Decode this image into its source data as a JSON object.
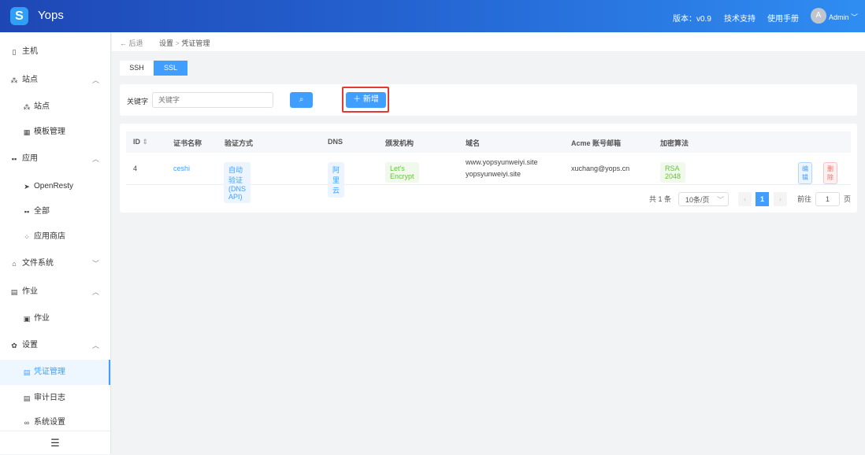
{
  "header": {
    "logo": "S",
    "brand": "Yops",
    "version": "版本：v0.9",
    "support": "技术支持",
    "manual": "使用手册",
    "avatar": "A",
    "user": "Admin"
  },
  "sidebar": {
    "items": [
      {
        "label": "主机",
        "icon": "host-icon"
      },
      {
        "label": "站点",
        "icon": "site-icon"
      },
      {
        "label": "站点",
        "icon": "site-icon"
      },
      {
        "label": "模板管理",
        "icon": "template-icon"
      },
      {
        "label": "应用",
        "icon": "apps-icon"
      },
      {
        "label": "OpenResty",
        "icon": "openresty-icon"
      },
      {
        "label": "全部",
        "icon": "grid-icon"
      },
      {
        "label": "应用商店",
        "icon": "store-icon"
      },
      {
        "label": "文件系统",
        "icon": "filesystem-icon"
      },
      {
        "label": "作业",
        "icon": "job-icon"
      },
      {
        "label": "作业",
        "icon": "clipboard-icon"
      },
      {
        "label": "设置",
        "icon": "gear-icon"
      },
      {
        "label": "凭证管理",
        "icon": "credential-icon"
      },
      {
        "label": "审计日志",
        "icon": "log-icon"
      },
      {
        "label": "系统设置",
        "icon": "link-icon"
      }
    ]
  },
  "breadcrumb": {
    "back": "后退",
    "parent": "设置",
    "current": "凭证管理"
  },
  "tabs": [
    "SSH",
    "SSL"
  ],
  "search": {
    "label": "关键字",
    "placeholder": "关键字",
    "add": "新增"
  },
  "table": {
    "headers": [
      "ID",
      "证书名称",
      "验证方式",
      "DNS",
      "颁发机构",
      "域名",
      "Acme 账号邮箱",
      "加密算法"
    ],
    "rows": [
      {
        "id": "4",
        "name": "ceshi",
        "verify": "自动验证(DNS API)",
        "dns": "阿里云",
        "issuer": "Let's Encrypt",
        "domain1": "www.yopsyunweiyi.site",
        "domain2": "yopsyunweiyi.site",
        "email": "xuchang@yops.cn",
        "algo": "RSA 2048",
        "edit": "编辑",
        "delete": "删除"
      }
    ]
  },
  "pagination": {
    "total": "共 1 条",
    "page_size": "10条/页",
    "current": "1",
    "goto": "前往",
    "goto_value": "1",
    "page_unit": "页"
  },
  "colors": {
    "accent": "#409eff",
    "highlight": "#e53935"
  }
}
